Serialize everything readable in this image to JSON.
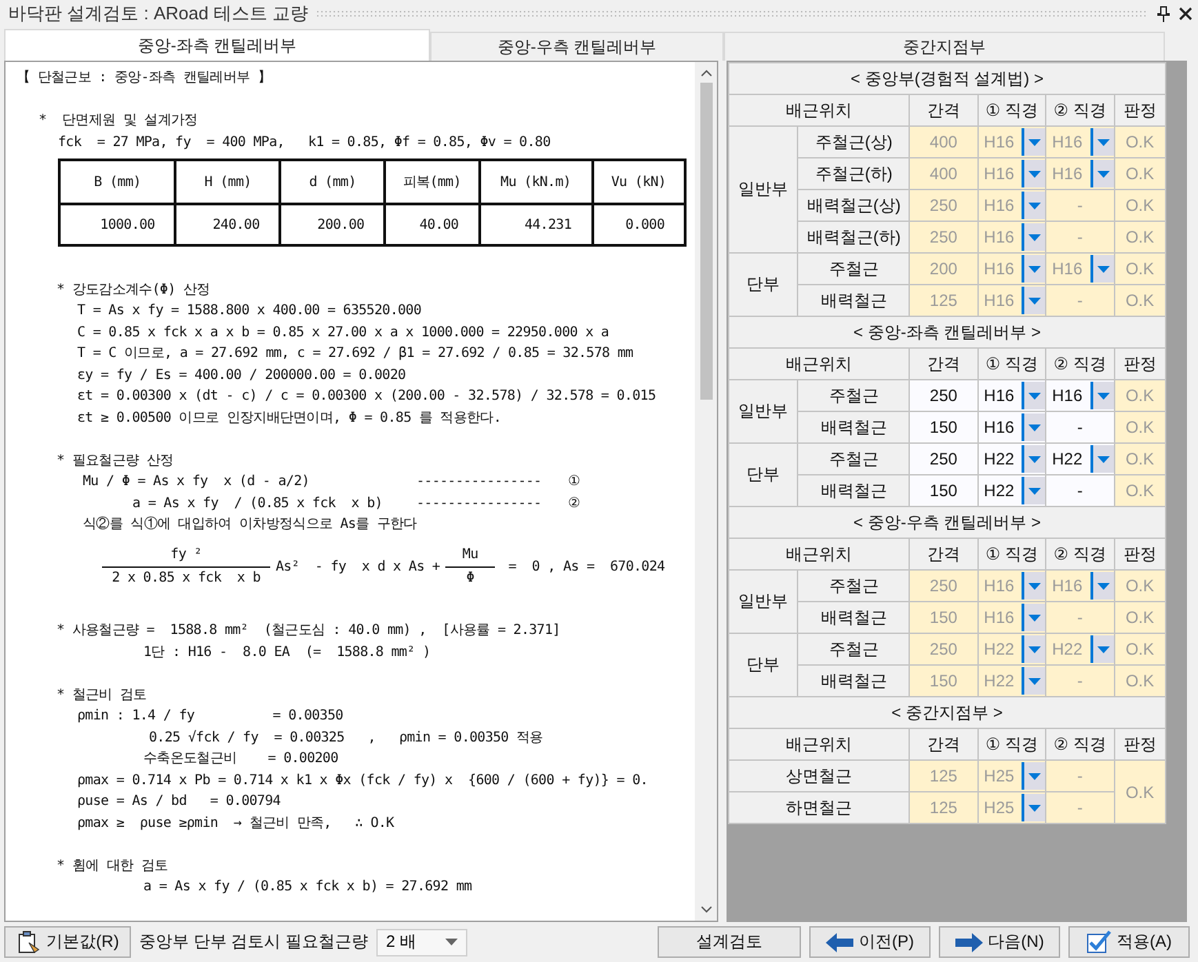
{
  "window": {
    "title": "바닥판 설계검토 : ARoad 테스트 교량"
  },
  "tabs": [
    {
      "label": "중앙-좌측 캔틸레버부",
      "selected": true
    },
    {
      "label": "중앙-우측 캔틸레버부",
      "selected": false
    },
    {
      "label": "중간지점부",
      "selected": false
    }
  ],
  "report": [
    {
      "kind": "title",
      "text": "【 단철근보 : 중앙-좌측 캔틸레버부 】"
    },
    {
      "kind": "blank"
    },
    {
      "kind": "head1",
      "text": "*  단면제원 및 설계가정"
    },
    {
      "kind": "text1",
      "text": "fck  = 27 MPa, fy  = 400 MPa,   k1 = 0.85, Φf = 0.85, Φv = 0.80"
    },
    {
      "kind": "table",
      "columns": [
        "B (mm)",
        "H (mm)",
        "d (mm)",
        "피복(mm)",
        "Mu (kN.m)",
        "Vu (kN)"
      ],
      "values": [
        "1000.00",
        "240.00",
        "200.00",
        "40.00",
        "44.231",
        "0.000"
      ]
    },
    {
      "kind": "blank"
    },
    {
      "kind": "head",
      "text": "* 강도감소계수(Φ) 산정"
    },
    {
      "kind": "text",
      "text": "T = As x fy = 1588.800 x 400.00 = 635520.000"
    },
    {
      "kind": "text",
      "text": "C = 0.85 x fck x a x b = 0.85 x 27.00 x a x 1000.000 = 22950.000 x a"
    },
    {
      "kind": "text",
      "text": "T = C 이므로, a = 27.692 mm, c = 27.692 / β1 = 27.692 / 0.85 = 32.578 mm"
    },
    {
      "kind": "text",
      "text": "εy = fy / Es = 400.00 / 200000.00 = 0.0020"
    },
    {
      "kind": "text",
      "text": "εt = 0.00300 x (dt - c) / c = 0.00300 x (200.00 - 32.578) / 32.578 = 0.015"
    },
    {
      "kind": "text",
      "text": "εt ≥ 0.00500 이므로 인장지배단면이며, Φ = 0.85 를 적용한다."
    },
    {
      "kind": "blank"
    },
    {
      "kind": "head",
      "text": "* 필요철근량 산정"
    },
    {
      "kind": "ref",
      "text": "Mu / Φ = As x fy  x (d - a/2)",
      "dashes": "----------------",
      "mark": "①"
    },
    {
      "kind": "ref-deep",
      "text": "a = As x fy  / (0.85 x fck  x b)",
      "dashes": "----------------",
      "mark": "②"
    },
    {
      "kind": "text-mid",
      "text": "식②를 식①에 대입하여 이차방정식으로 As를 구한다"
    },
    {
      "kind": "fraction",
      "left_num": "fy ²",
      "left_den": "2 x 0.85 x fck  x b",
      "middle": "As²  - fy  x d x As +",
      "right_num": "Mu",
      "right_den": "Φ",
      "result": "=  0 , As =  670.024"
    },
    {
      "kind": "blank"
    },
    {
      "kind": "head",
      "text": "* 사용철근량 =  1588.8 mm²  (철근도심 : 40.0 mm) ,  [사용률 = 2.371]"
    },
    {
      "kind": "deep",
      "text": "1단 : H16 -  8.0 EA  (=  1588.8 mm² )"
    },
    {
      "kind": "blank"
    },
    {
      "kind": "head",
      "text": "* 철근비 검토"
    },
    {
      "kind": "text",
      "text": "ρmin : 1.4 / fy          = 0.00350"
    },
    {
      "kind": "deeper",
      "text": "0.25 √fck / fy  = 0.00325   ,   ρmin = 0.00350 적용"
    },
    {
      "kind": "deep",
      "text": "수축온도철근비    = 0.00200"
    },
    {
      "kind": "text",
      "text": "ρmax = 0.714 x Pb = 0.714 x k1 x Φx (fck / fy) x  {600 / (600 + fy)} = 0."
    },
    {
      "kind": "text",
      "text": "ρuse = As / bd   = 0.00794"
    },
    {
      "kind": "text",
      "text": "ρmax ≥  ρuse ≥ρmin  → 철근비 만족,   ∴ O.K"
    },
    {
      "kind": "blank"
    },
    {
      "kind": "head",
      "text": "* 휨에 대한 검토"
    },
    {
      "kind": "deep",
      "text": "a = As x fy / (0.85 x fck x b) = 27.692 mm"
    }
  ],
  "sections": [
    {
      "title": "< 중앙부(경험적 설계법) >",
      "editable": false,
      "headers": [
        "배근위치",
        "간격",
        "① 직경",
        "② 직경",
        "판정"
      ],
      "groups": [
        {
          "label": "일반부",
          "rows": [
            {
              "name": "주철근(상)",
              "spacing": "400",
              "dia1": {
                "kind": "select",
                "value": "H16"
              },
              "dia2": {
                "kind": "select",
                "value": "H16"
              },
              "judgement": "O.K"
            },
            {
              "name": "주철근(하)",
              "spacing": "400",
              "dia1": {
                "kind": "select",
                "value": "H16"
              },
              "dia2": {
                "kind": "select",
                "value": "H16"
              },
              "judgement": "O.K"
            },
            {
              "name": "배력철근(상)",
              "spacing": "250",
              "dia1": {
                "kind": "select",
                "value": "H16"
              },
              "dia2": {
                "kind": "none",
                "value": "-"
              },
              "judgement": "O.K"
            },
            {
              "name": "배력철근(하)",
              "spacing": "250",
              "dia1": {
                "kind": "select",
                "value": "H16"
              },
              "dia2": {
                "kind": "none",
                "value": "-"
              },
              "judgement": "O.K"
            }
          ]
        },
        {
          "label": "단부",
          "rows": [
            {
              "name": "주철근",
              "spacing": "200",
              "dia1": {
                "kind": "select",
                "value": "H16"
              },
              "dia2": {
                "kind": "select",
                "value": "H16"
              },
              "judgement": "O.K"
            },
            {
              "name": "배력철근",
              "spacing": "125",
              "dia1": {
                "kind": "select",
                "value": "H16"
              },
              "dia2": {
                "kind": "none",
                "value": "-"
              },
              "judgement": "O.K"
            }
          ]
        }
      ]
    },
    {
      "title": "< 중앙-좌측 캔틸레버부 >",
      "editable": true,
      "headers": [
        "배근위치",
        "간격",
        "① 직경",
        "② 직경",
        "판정"
      ],
      "groups": [
        {
          "label": "일반부",
          "rows": [
            {
              "name": "주철근",
              "spacing": "250",
              "dia1": {
                "kind": "select",
                "value": "H16"
              },
              "dia2": {
                "kind": "select",
                "value": "H16"
              },
              "judgement": "O.K"
            },
            {
              "name": "배력철근",
              "spacing": "150",
              "dia1": {
                "kind": "select",
                "value": "H16"
              },
              "dia2": {
                "kind": "none",
                "value": "-"
              },
              "judgement": "O.K"
            }
          ]
        },
        {
          "label": "단부",
          "rows": [
            {
              "name": "주철근",
              "spacing": "250",
              "dia1": {
                "kind": "select",
                "value": "H22"
              },
              "dia2": {
                "kind": "select",
                "value": "H22"
              },
              "judgement": "O.K"
            },
            {
              "name": "배력철근",
              "spacing": "150",
              "dia1": {
                "kind": "select",
                "value": "H22"
              },
              "dia2": {
                "kind": "none",
                "value": "-"
              },
              "judgement": "O.K"
            }
          ]
        }
      ]
    },
    {
      "title": "< 중앙-우측 캔틸레버부 >",
      "editable": false,
      "headers": [
        "배근위치",
        "간격",
        "① 직경",
        "② 직경",
        "판정"
      ],
      "groups": [
        {
          "label": "일반부",
          "rows": [
            {
              "name": "주철근",
              "spacing": "250",
              "dia1": {
                "kind": "select",
                "value": "H16"
              },
              "dia2": {
                "kind": "select",
                "value": "H16"
              },
              "judgement": "O.K"
            },
            {
              "name": "배력철근",
              "spacing": "150",
              "dia1": {
                "kind": "select",
                "value": "H16"
              },
              "dia2": {
                "kind": "none",
                "value": "-"
              },
              "judgement": "O.K"
            }
          ]
        },
        {
          "label": "단부",
          "rows": [
            {
              "name": "주철근",
              "spacing": "250",
              "dia1": {
                "kind": "select",
                "value": "H22"
              },
              "dia2": {
                "kind": "select",
                "value": "H22"
              },
              "judgement": "O.K"
            },
            {
              "name": "배력철근",
              "spacing": "150",
              "dia1": {
                "kind": "select",
                "value": "H22"
              },
              "dia2": {
                "kind": "none",
                "value": "-"
              },
              "judgement": "O.K"
            }
          ]
        }
      ]
    },
    {
      "title": "< 중간지점부 >",
      "editable": false,
      "headers": [
        "배근위치",
        "간격",
        "① 직경",
        "② 직경",
        "판정"
      ],
      "judgement": "O.K",
      "groups": [
        {
          "rows": [
            {
              "name": "상면철근",
              "spacing": "125",
              "dia1": {
                "kind": "select",
                "value": "H25"
              },
              "dia2": {
                "kind": "none",
                "value": "-"
              }
            },
            {
              "name": "하면철근",
              "spacing": "125",
              "dia1": {
                "kind": "select",
                "value": "H25"
              },
              "dia2": {
                "kind": "none",
                "value": "-"
              }
            }
          ]
        }
      ]
    }
  ],
  "footer": {
    "default_button": "기본값(R)",
    "ratio_label": "중앙부 단부 검토시 필요철근량",
    "ratio_value": "2 배",
    "buttons": [
      {
        "kind": "plain",
        "label": "설계검토"
      },
      {
        "kind": "prev",
        "label": "이전(P)"
      },
      {
        "kind": "next",
        "label": "다음(N)"
      },
      {
        "kind": "apply",
        "label": "적용(A)"
      }
    ]
  }
}
